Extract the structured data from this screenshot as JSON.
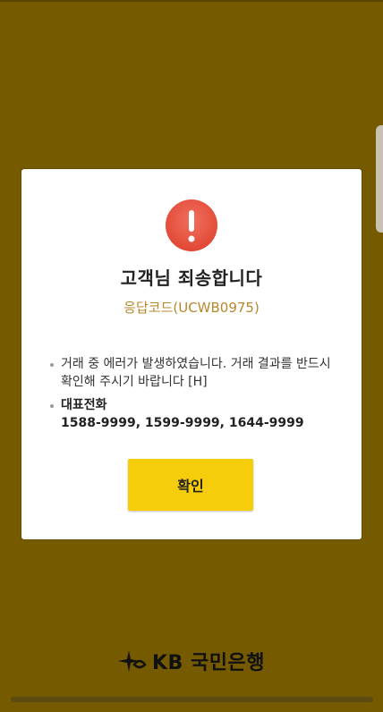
{
  "dialog": {
    "title": "고객님 죄송합니다",
    "response_code": "응답코드(UCWB0975)",
    "message": "거래 중 에러가 발생하였습니다. 거래 결과를 반드시 확인해 주시기 바랍니다 [H]",
    "phone_label": "대표전화",
    "phone_numbers": "1588-9999, 1599-9999, 1644-9999",
    "confirm_label": "확인"
  },
  "footer": {
    "logo_text": "KB 국민은행"
  },
  "colors": {
    "background": "#755a00",
    "alert_red": "#e24b37",
    "code_text": "#b8862b",
    "confirm_button": "#f6cd0b"
  },
  "icons": {
    "alert": "exclamation-circle-icon",
    "logo": "kb-star-logo-icon"
  }
}
